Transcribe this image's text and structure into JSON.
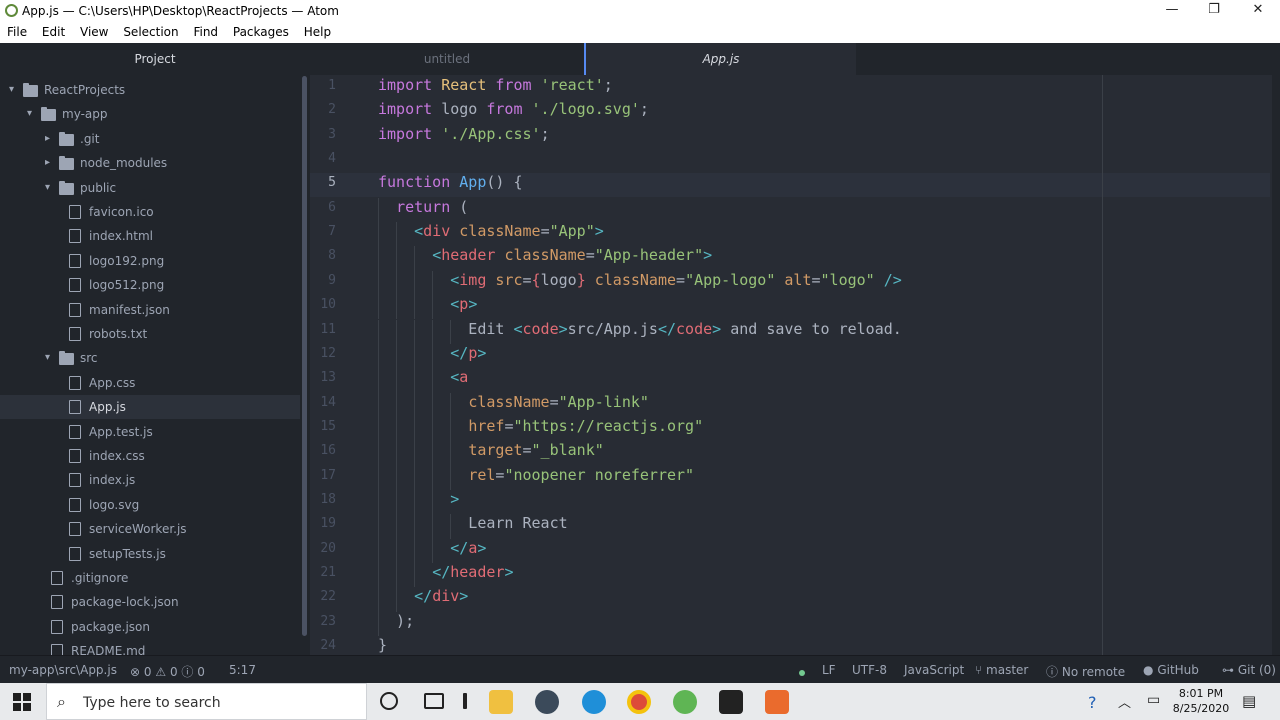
{
  "window": {
    "title": "App.js — C:\\Users\\HP\\Desktop\\ReactProjects — Atom",
    "minimize_glyph": "—",
    "maximize_glyph": "❐",
    "close_glyph": "✕"
  },
  "menu": [
    "File",
    "Edit",
    "View",
    "Selection",
    "Find",
    "Packages",
    "Help"
  ],
  "tree": {
    "title": "Project",
    "items": [
      {
        "label": "ReactProjects",
        "type": "folder",
        "expanded": true,
        "depth": 0
      },
      {
        "label": "my-app",
        "type": "folder",
        "expanded": true,
        "depth": 1
      },
      {
        "label": ".git",
        "type": "folder",
        "expanded": false,
        "depth": 2
      },
      {
        "label": "node_modules",
        "type": "folder",
        "expanded": false,
        "depth": 2
      },
      {
        "label": "public",
        "type": "folder",
        "expanded": true,
        "depth": 2
      },
      {
        "label": "favicon.ico",
        "type": "file",
        "depth": 3
      },
      {
        "label": "index.html",
        "type": "file",
        "depth": 3
      },
      {
        "label": "logo192.png",
        "type": "file",
        "depth": 3
      },
      {
        "label": "logo512.png",
        "type": "file",
        "depth": 3
      },
      {
        "label": "manifest.json",
        "type": "file",
        "depth": 3
      },
      {
        "label": "robots.txt",
        "type": "file",
        "depth": 3
      },
      {
        "label": "src",
        "type": "folder",
        "expanded": true,
        "depth": 2
      },
      {
        "label": "App.css",
        "type": "file",
        "depth": 3
      },
      {
        "label": "App.js",
        "type": "file",
        "depth": 3,
        "selected": true
      },
      {
        "label": "App.test.js",
        "type": "file",
        "depth": 3
      },
      {
        "label": "index.css",
        "type": "file",
        "depth": 3
      },
      {
        "label": "index.js",
        "type": "file",
        "depth": 3
      },
      {
        "label": "logo.svg",
        "type": "file",
        "depth": 3
      },
      {
        "label": "serviceWorker.js",
        "type": "file",
        "depth": 3
      },
      {
        "label": "setupTests.js",
        "type": "file",
        "depth": 3
      },
      {
        "label": ".gitignore",
        "type": "file",
        "depth": 2
      },
      {
        "label": "package-lock.json",
        "type": "file",
        "depth": 2
      },
      {
        "label": "package.json",
        "type": "file",
        "depth": 2
      },
      {
        "label": "README.md",
        "type": "file",
        "depth": 2
      }
    ]
  },
  "tabs": [
    {
      "label": "untitled",
      "active": false
    },
    {
      "label": "App.js",
      "active": true
    }
  ],
  "editor": {
    "active_line": 5,
    "lines": [
      [
        [
          "kw",
          "import"
        ],
        [
          "pl",
          " "
        ],
        [
          "cls",
          "React"
        ],
        [
          "pl",
          " "
        ],
        [
          "kw",
          "from"
        ],
        [
          "pl",
          " "
        ],
        [
          "str",
          "'react'"
        ],
        [
          "pl",
          ";"
        ]
      ],
      [
        [
          "kw",
          "import"
        ],
        [
          "pl",
          " logo "
        ],
        [
          "kw",
          "from"
        ],
        [
          "pl",
          " "
        ],
        [
          "str",
          "'./logo.svg'"
        ],
        [
          "pl",
          ";"
        ]
      ],
      [
        [
          "kw",
          "import"
        ],
        [
          "pl",
          " "
        ],
        [
          "str",
          "'./App.css'"
        ],
        [
          "pl",
          ";"
        ]
      ],
      [],
      [
        [
          "kw",
          "function"
        ],
        [
          "pl",
          " "
        ],
        [
          "fn",
          "App"
        ],
        [
          "pl",
          "() {"
        ]
      ],
      [
        [
          "pl",
          "  "
        ],
        [
          "kw",
          "return"
        ],
        [
          "pl",
          " ("
        ]
      ],
      [
        [
          "pl",
          "    "
        ],
        [
          "punc",
          "<"
        ],
        [
          "tag",
          "div"
        ],
        [
          "pl",
          " "
        ],
        [
          "attr",
          "className"
        ],
        [
          "pl",
          "="
        ],
        [
          "str",
          "\"App\""
        ],
        [
          "punc",
          ">"
        ]
      ],
      [
        [
          "pl",
          "      "
        ],
        [
          "punc",
          "<"
        ],
        [
          "tag",
          "header"
        ],
        [
          "pl",
          " "
        ],
        [
          "attr",
          "className"
        ],
        [
          "pl",
          "="
        ],
        [
          "str",
          "\"App-header\""
        ],
        [
          "punc",
          ">"
        ]
      ],
      [
        [
          "pl",
          "        "
        ],
        [
          "punc",
          "<"
        ],
        [
          "tag",
          "img"
        ],
        [
          "pl",
          " "
        ],
        [
          "attr",
          "src"
        ],
        [
          "pl",
          "="
        ],
        [
          "tag",
          "{"
        ],
        [
          "pl",
          "logo"
        ],
        [
          "tag",
          "}"
        ],
        [
          "pl",
          " "
        ],
        [
          "attr",
          "className"
        ],
        [
          "pl",
          "="
        ],
        [
          "str",
          "\"App-logo\""
        ],
        [
          "pl",
          " "
        ],
        [
          "attr",
          "alt"
        ],
        [
          "pl",
          "="
        ],
        [
          "str",
          "\"logo\""
        ],
        [
          "pl",
          " "
        ],
        [
          "punc",
          "/>"
        ]
      ],
      [
        [
          "pl",
          "        "
        ],
        [
          "punc",
          "<"
        ],
        [
          "tag",
          "p"
        ],
        [
          "punc",
          ">"
        ]
      ],
      [
        [
          "pl",
          "          Edit "
        ],
        [
          "punc",
          "<"
        ],
        [
          "tag",
          "code"
        ],
        [
          "punc",
          ">"
        ],
        [
          "pl",
          "src/App.js"
        ],
        [
          "punc",
          "</"
        ],
        [
          "tag",
          "code"
        ],
        [
          "punc",
          ">"
        ],
        [
          "pl",
          " and save to reload."
        ]
      ],
      [
        [
          "pl",
          "        "
        ],
        [
          "punc",
          "</"
        ],
        [
          "tag",
          "p"
        ],
        [
          "punc",
          ">"
        ]
      ],
      [
        [
          "pl",
          "        "
        ],
        [
          "punc",
          "<"
        ],
        [
          "tag",
          "a"
        ]
      ],
      [
        [
          "pl",
          "          "
        ],
        [
          "attr",
          "className"
        ],
        [
          "pl",
          "="
        ],
        [
          "str",
          "\"App-link\""
        ]
      ],
      [
        [
          "pl",
          "          "
        ],
        [
          "attr",
          "href"
        ],
        [
          "pl",
          "="
        ],
        [
          "str",
          "\"https://reactjs.org\""
        ]
      ],
      [
        [
          "pl",
          "          "
        ],
        [
          "attr",
          "target"
        ],
        [
          "pl",
          "="
        ],
        [
          "str",
          "\"_blank\""
        ]
      ],
      [
        [
          "pl",
          "          "
        ],
        [
          "attr",
          "rel"
        ],
        [
          "pl",
          "="
        ],
        [
          "str",
          "\"noopener noreferrer\""
        ]
      ],
      [
        [
          "pl",
          "        "
        ],
        [
          "punc",
          ">"
        ]
      ],
      [
        [
          "pl",
          "          Learn React"
        ]
      ],
      [
        [
          "pl",
          "        "
        ],
        [
          "punc",
          "</"
        ],
        [
          "tag",
          "a"
        ],
        [
          "punc",
          ">"
        ]
      ],
      [
        [
          "pl",
          "      "
        ],
        [
          "punc",
          "</"
        ],
        [
          "tag",
          "header"
        ],
        [
          "punc",
          ">"
        ]
      ],
      [
        [
          "pl",
          "    "
        ],
        [
          "punc",
          "</"
        ],
        [
          "tag",
          "div"
        ],
        [
          "punc",
          ">"
        ]
      ],
      [
        [
          "pl",
          "  );"
        ]
      ],
      [
        [
          "pl",
          "}"
        ]
      ]
    ]
  },
  "status": {
    "path": "my-app\\src\\App.js",
    "errors": "0",
    "warnings": "0",
    "infos": "0",
    "cursor": "5:17",
    "line_ending": "LF",
    "encoding": "UTF-8",
    "grammar": "JavaScript",
    "branch": "master",
    "remote": "No remote",
    "github": "GitHub",
    "git": "Git (0)"
  },
  "taskbar": {
    "search_placeholder": "Type here to search",
    "time": "8:01 PM",
    "date": "8/25/2020"
  }
}
